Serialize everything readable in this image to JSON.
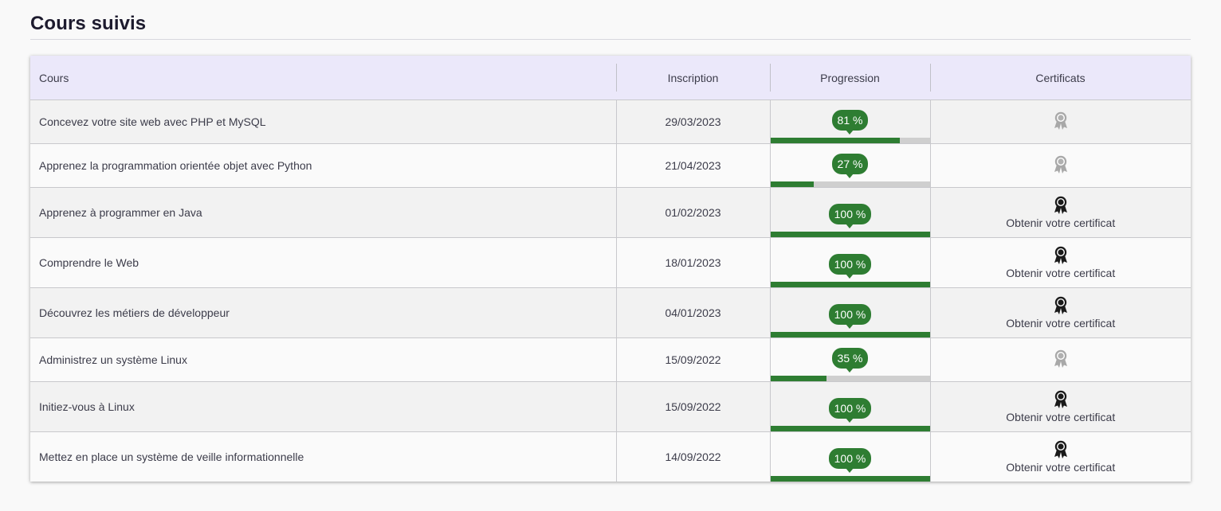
{
  "page_title": "Cours suivis",
  "table": {
    "headers": {
      "course": "Cours",
      "enrollment": "Inscription",
      "progress": "Progression",
      "certificates": "Certificats"
    },
    "rows": [
      {
        "course": "Concevez votre site web avec PHP et MySQL",
        "date": "29/03/2023",
        "progress_label": "81 %",
        "progress": 81,
        "certificate_available": false,
        "certificate_icon": "award-ribbon-icon-grey",
        "certificate_link": ""
      },
      {
        "course": "Apprenez la programmation orientée objet avec Python",
        "date": "21/04/2023",
        "progress_label": "27 %",
        "progress": 27,
        "certificate_available": false,
        "certificate_icon": "award-ribbon-icon-grey",
        "certificate_link": ""
      },
      {
        "course": "Apprenez à programmer en Java",
        "date": "01/02/2023",
        "progress_label": "100 %",
        "progress": 100,
        "certificate_available": true,
        "certificate_icon": "award-ribbon-icon-black",
        "certificate_link": "Obtenir votre certificat"
      },
      {
        "course": "Comprendre le Web",
        "date": "18/01/2023",
        "progress_label": "100 %",
        "progress": 100,
        "certificate_available": true,
        "certificate_icon": "award-ribbon-icon-black",
        "certificate_link": "Obtenir votre certificat"
      },
      {
        "course": "Découvrez les métiers de développeur",
        "date": "04/01/2023",
        "progress_label": "100 %",
        "progress": 100,
        "certificate_available": true,
        "certificate_icon": "award-ribbon-icon-black",
        "certificate_link": "Obtenir votre certificat"
      },
      {
        "course": "Administrez un système Linux",
        "date": "15/09/2022",
        "progress_label": "35 %",
        "progress": 35,
        "certificate_available": false,
        "certificate_icon": "award-ribbon-icon-grey",
        "certificate_link": ""
      },
      {
        "course": "Initiez-vous à Linux",
        "date": "15/09/2022",
        "progress_label": "100 %",
        "progress": 100,
        "certificate_available": true,
        "certificate_icon": "award-ribbon-icon-black",
        "certificate_link": "Obtenir votre certificat"
      },
      {
        "course": "Mettez en place un système de veille informationnelle",
        "date": "14/09/2022",
        "progress_label": "100 %",
        "progress": 100,
        "certificate_available": true,
        "certificate_icon": "award-ribbon-icon-black",
        "certificate_link": "Obtenir votre certificat"
      }
    ]
  },
  "colors": {
    "header_bg": "#ebe8fa",
    "progress_green": "#2e7d32",
    "progress_track": "#cfcfcf",
    "badge_locked": "#a8a8a8",
    "badge_unlocked": "#1a1a1a"
  }
}
